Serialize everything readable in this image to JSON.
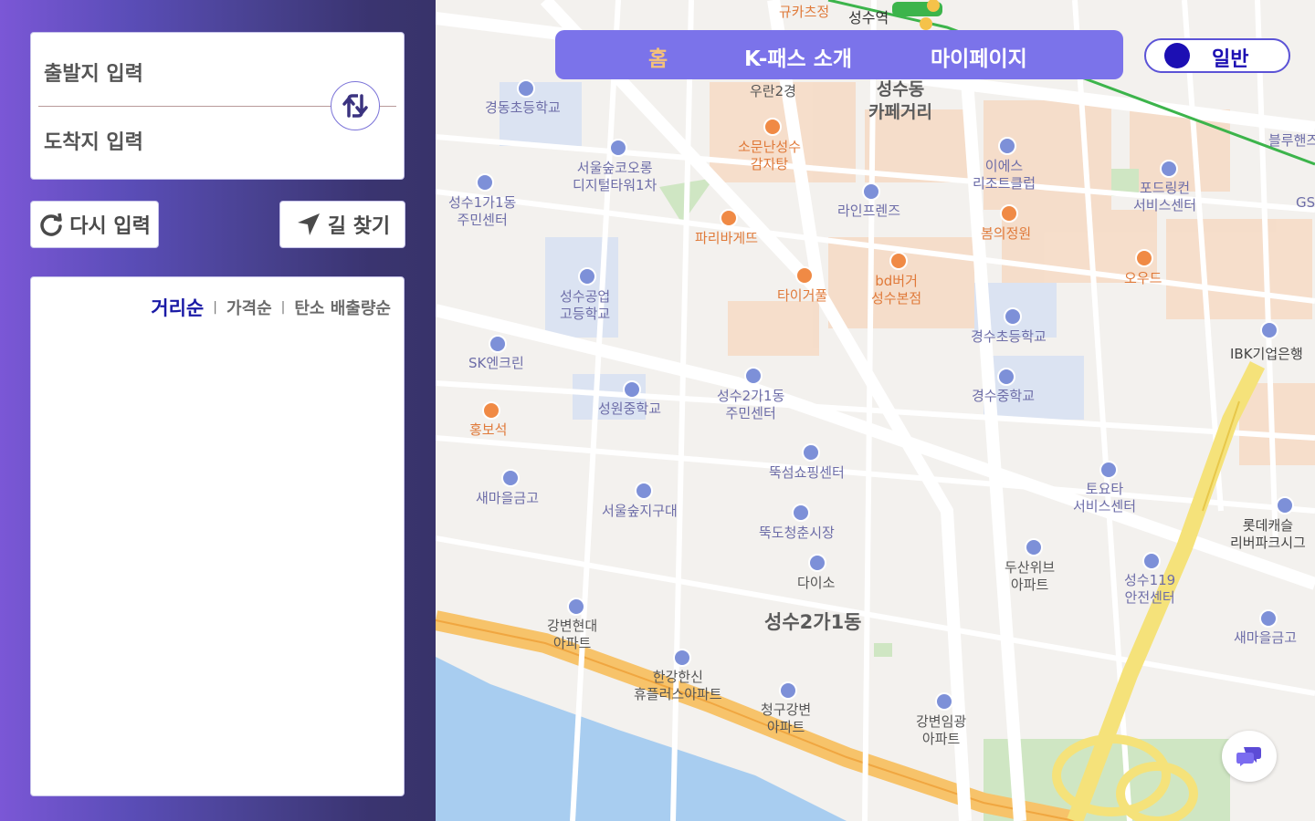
{
  "sidebar": {
    "origin_placeholder": "출발지 입력",
    "destination_placeholder": "도착지 입력",
    "reset_label": "다시 입력",
    "find_label": "길 찾기",
    "sort_options": [
      "거리순",
      "가격순",
      "탄소 배출량순"
    ],
    "active_sort": "거리순"
  },
  "nav": {
    "home": "홈",
    "about": "K-패스 소개",
    "mypage": "마이페이지"
  },
  "toggle": {
    "label": "일반"
  },
  "colors": {
    "accent": "#7b73ea",
    "active_nav": "#f5c27a",
    "toggle": "#1c0fb3",
    "sort_active": "#1a1aa6"
  },
  "map": {
    "labels": {
      "station": "성수역",
      "gyukatsu": "규카츠정",
      "woran": "우란2경",
      "cafe_street": "성수동\n카페거리",
      "gyeongdong": "경동초등학교",
      "somun": "소문난성수\n감자탕",
      "forest_tower": "서울숲코오롱\n디지털타워1차",
      "seongsu1": "성수1가1동\n주민센터",
      "paris": "파리바게뜨",
      "lineblue": "라인프렌즈",
      "ies": "이에스\n리조트클럽",
      "bomui": "봄의정원",
      "ford": "포드링컨\n서비스센터",
      "oowood": "오우드",
      "bdburger": "bd버거\n성수본점",
      "taiger": "타이거풀",
      "technical_high": "성수공업\n고등학교",
      "gyeongsu_elem": "경수초등학교",
      "ibk": "IBK기업은행",
      "sk": "SK엔크린",
      "seongsu2": "성수2가1동\n주민센터",
      "seongwon": "성원중학교",
      "gyeongsu_mid": "경수중학교",
      "hongbo": "홍보석",
      "ttukseom_shop": "뚝섬쇼핑센터",
      "toyota": "토요타\n서비스센터",
      "saemaeul1": "새마을금고",
      "forest_district": "서울숲지구대",
      "ttukdo": "뚝도청춘시장",
      "lotte": "롯데캐슬\n리버파크시그",
      "doosan": "두산위브\n아파트",
      "daiso": "다이소",
      "safety": "성수119\n안전센터",
      "gangbyeon_hd": "강변현대\n아파트",
      "area_seongsu2": "성수2가1동",
      "saemaeul2": "새마을금고",
      "hangang": "한강한신\n휴플러스아파트",
      "chunggu": "청구강변\n아파트",
      "gangbyeon_im": "강변임광\n아파트",
      "bluehands": "블루핸즈",
      "gs": "GS"
    }
  }
}
